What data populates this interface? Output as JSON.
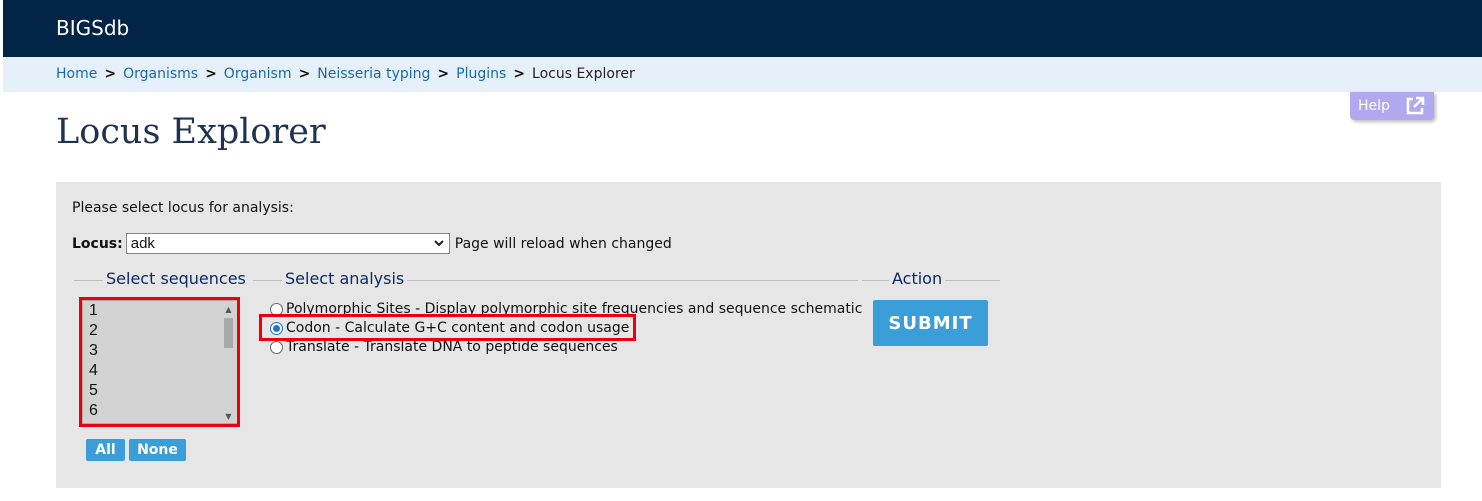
{
  "header": {
    "brand": "BIGSdb"
  },
  "breadcrumbs": {
    "items": [
      "Home",
      "Organisms",
      "Organism",
      "Neisseria typing",
      "Plugins"
    ],
    "current": "Locus Explorer",
    "separator": ">"
  },
  "help": {
    "label": "Help",
    "icon": "external-link-icon"
  },
  "page": {
    "title": "Locus Explorer"
  },
  "form": {
    "prompt": "Please select locus for analysis:",
    "locus_label": "Locus:",
    "locus_value": "adk",
    "locus_note": "Page will reload when changed",
    "sequences": {
      "legend": "Select sequences",
      "options": [
        "1",
        "2",
        "3",
        "4",
        "5",
        "6"
      ],
      "all_label": "All",
      "none_label": "None"
    },
    "analysis": {
      "legend": "Select analysis",
      "options": [
        {
          "label": "Polymorphic Sites - Display polymorphic site frequencies and sequence schematic",
          "selected": false
        },
        {
          "label": "Codon - Calculate G+C content and codon usage",
          "selected": true
        },
        {
          "label": "Translate - Translate DNA to peptide sequences",
          "selected": false
        }
      ]
    },
    "action": {
      "legend": "Action",
      "submit_label": "SUBMIT"
    }
  },
  "colors": {
    "topbar": "#022447",
    "breadcrumb_bg": "#e6f0fa",
    "button": "#3a9ed8",
    "help_button": "#b1a9f0",
    "highlight": "#e8000b"
  }
}
